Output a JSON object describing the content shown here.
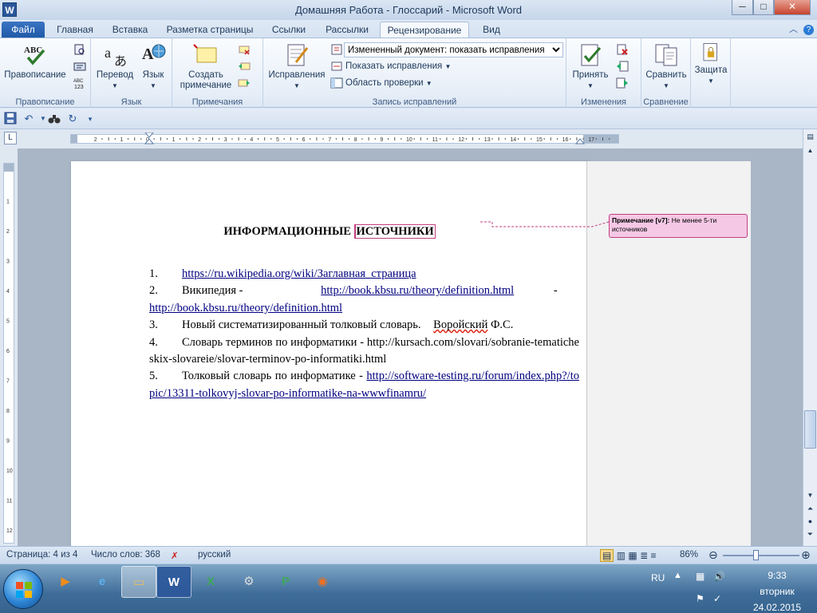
{
  "window": {
    "title": "Домашняя Работа - Глоссарий - Microsoft Word",
    "app_icon": "W",
    "minimize": "─",
    "maximize": "□",
    "close": "✕"
  },
  "tabs": [
    "Файл",
    "Главная",
    "Вставка",
    "Разметка страницы",
    "Ссылки",
    "Рассылки",
    "Рецензирование",
    "Вид"
  ],
  "active_tab": "Рецензирование",
  "ribbon": {
    "proofing": {
      "spelling": "Правописание",
      "group": "Правописание"
    },
    "language": {
      "translate": "Перевод",
      "language": "Язык",
      "group": "Язык"
    },
    "comments": {
      "new_comment_line1": "Создать",
      "new_comment_line2": "примечание",
      "group": "Примечания"
    },
    "tracking": {
      "track_changes": "Исправления",
      "display_mode": "Измененный документ: показать исправления",
      "show_markup": "Показать исправления",
      "reviewing_pane": "Область проверки",
      "group": "Запись исправлений"
    },
    "changes": {
      "accept": "Принять",
      "group": "Изменения"
    },
    "compare": {
      "compare": "Сравнить",
      "group": "Сравнение"
    },
    "protect": {
      "protect": "Защита"
    }
  },
  "document": {
    "title_part1": "ИНФОРМАЦИОННЫЕ",
    "title_part2": "ИСТОЧНИКИ",
    "items": [
      {
        "num": "1.",
        "pre": "",
        "link": "https://ru.wikipedia.org/wiki/Заглавная_страница",
        "post": ""
      },
      {
        "num": "2.",
        "pre": "Википедия - ",
        "link": "http://book.kbsu.ru/theory/definition.html",
        "mid": " - ",
        "link2": "http://book.kbsu.ru/theory/definition.html"
      },
      {
        "num": "3.",
        "pre": "Новый систематизированный толковый словарь.",
        "sq": "Воройский",
        "post": " Ф.С."
      },
      {
        "num": "4.",
        "pre": "Словарь терминов по информатики - http://kursach.com/slovari/sobranie-tematicheskix-slovareie/slovar-terminov-po-informatiki.html"
      },
      {
        "num": "5.",
        "pre": "Толковый словарь по информатике - ",
        "link": "http://software-testing.ru/forum/index.php?/topic/13311-tolkovyj-slovar-po-informatike-na-wwwfinamru/"
      }
    ],
    "comment_label": "Примечание [v7]:",
    "comment_text": "Не менее 5-ти источников"
  },
  "statusbar": {
    "page": "Страница: 4 из 4",
    "words": "Число слов: 368",
    "language": "русский",
    "zoom": "86%",
    "zoom_fraction": 0.43
  },
  "taskbar": {
    "lang": "RU",
    "time": "9:33",
    "day": "вторник",
    "date": "24.02.2015"
  },
  "colors": {
    "accent": "#2b579a",
    "comment": "#c23e7f",
    "link": "#000080"
  }
}
